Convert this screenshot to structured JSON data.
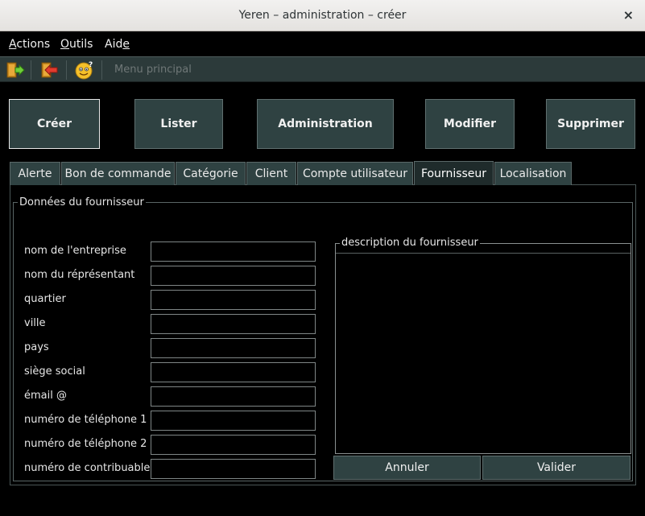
{
  "window": {
    "title": "Yeren – administration – créer",
    "close_glyph": "×"
  },
  "menu": {
    "actions": {
      "first": "A",
      "rest": "ctions"
    },
    "outils": {
      "first": "O",
      "rest": "utils"
    },
    "aide": {
      "pre": "Aid",
      "u": "e"
    }
  },
  "toolbar": {
    "icons": [
      "enter-door-icon",
      "exit-door-icon",
      "help-smiley-icon"
    ],
    "main_menu": "Menu principal"
  },
  "main_buttons": [
    "Créer",
    "Lister",
    "Administration",
    "Modifier",
    "Supprimer"
  ],
  "tabs": [
    "Alerte",
    "Bon de commande",
    "Catégorie",
    "Client",
    "Compte utilisateur",
    "Fournisseur",
    "Localisation"
  ],
  "selected_tab": "Fournisseur",
  "form": {
    "group_title": "Données du fournisseur",
    "fields": [
      {
        "label": "nom de l'entreprise",
        "value": ""
      },
      {
        "label": "nom du réprésentant",
        "value": ""
      },
      {
        "label": "quartier",
        "value": ""
      },
      {
        "label": "ville",
        "value": ""
      },
      {
        "label": "pays",
        "value": ""
      },
      {
        "label": "siège social",
        "value": ""
      },
      {
        "label": "émail @",
        "value": ""
      },
      {
        "label": "numéro de téléphone 1",
        "value": ""
      },
      {
        "label": "numéro de téléphone 2",
        "value": ""
      },
      {
        "label": "numéro de contribuable",
        "value": ""
      }
    ],
    "description_title": "description du fournisseur",
    "description_value": "",
    "cancel_label": "Annuler",
    "submit_label": "Valider"
  },
  "colors": {
    "button_bg": "#2f4242",
    "toolbar_bg": "#2c3a3a",
    "background": "#000000",
    "titlebar_bg": "#efeeec"
  }
}
